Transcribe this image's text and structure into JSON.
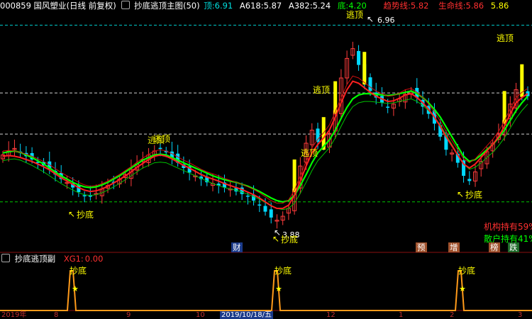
{
  "header": {
    "stock_code_name": "000859 国风塑业(日线 前复权)",
    "indicator_icon": "lock-icon",
    "indicator_name": "抄底逃顶主图(50)",
    "top_label": "顶:",
    "top_value": "6.91",
    "a618_label": "A618:",
    "a618_value": "5.87",
    "a382_label": "A382:",
    "a382_value": "5.24",
    "bottom_label": "底:",
    "bottom_value": "4.20",
    "trend_label": "趋势线:",
    "trend_value": "5.82",
    "life_label": "生命线:",
    "life_value": "5.86",
    "life_value2": "5.86",
    "colors": {
      "code": "#ffffff",
      "top": "#ffffff",
      "a": "#ffffff",
      "bottom": "#00ff00",
      "trend": "#ff3030",
      "life": "#ff3030"
    }
  },
  "annotations": {
    "escape": "逃顶",
    "escape_overlap": "逃顶",
    "bottom": "抄底",
    "price_high": "6.96",
    "price_low": "3.88",
    "arrow_high": "↖",
    "arrow_low": "↖"
  },
  "side_info": {
    "institution": "机构持有59%",
    "retail": "散户持有41%"
  },
  "badges": {
    "finance": "财",
    "forecast": "预",
    "increase": "增",
    "ranking": "榜",
    "drop": "跌"
  },
  "sub_panel": {
    "icon": "lock-icon",
    "title": "抄底逃顶副",
    "xg1_label": "XG1:",
    "xg1_value": "0.00",
    "spike_label": "抄底",
    "star_icon": "star-icon"
  },
  "date_axis": {
    "year": "2019年",
    "m8": "8",
    "m9": "9",
    "m10": "10",
    "cursor_date": "2019/10/18/五",
    "m12": "12",
    "m1": "1",
    "m2": "2",
    "m3": "3"
  },
  "chart_data": {
    "type": "candlestick",
    "title": "000859 国风塑业(日线 前复权)",
    "reference_levels": {
      "top": 6.91,
      "a618": 5.87,
      "a382": 5.24,
      "bottom": 4.2
    },
    "trend_line_last": 5.82,
    "life_line_last": 5.86,
    "annotated_prices": {
      "high": 6.96,
      "low": 3.88
    },
    "ylim": [
      3.6,
      7.1
    ],
    "close_path": [
      4.92,
      4.98,
      5.02,
      4.95,
      4.9,
      4.85,
      4.8,
      4.76,
      4.7,
      4.62,
      4.55,
      4.5,
      4.42,
      4.35,
      4.3,
      4.28,
      4.33,
      4.4,
      4.45,
      4.5,
      4.55,
      4.62,
      4.7,
      4.78,
      4.85,
      4.92,
      4.98,
      5.02,
      4.96,
      4.88,
      4.8,
      4.72,
      4.65,
      4.6,
      4.55,
      4.5,
      4.48,
      4.45,
      4.42,
      4.4,
      4.36,
      4.32,
      4.28,
      4.22,
      4.15,
      4.05,
      3.96,
      3.92,
      3.98,
      4.1,
      4.4,
      4.75,
      5.1,
      5.3,
      5.12,
      5.05,
      5.25,
      5.6,
      6.1,
      6.4,
      6.55,
      6.3,
      6.05,
      5.9,
      5.8,
      5.72,
      5.65,
      5.7,
      5.78,
      5.85,
      5.9,
      5.8,
      5.66,
      5.55,
      5.4,
      5.2,
      5.0,
      4.95,
      4.8,
      4.6,
      4.52,
      4.66,
      4.82,
      4.97,
      5.1,
      5.25,
      5.45,
      5.7,
      5.92,
      5.86,
      5.82
    ],
    "ma_green": [
      4.95,
      4.97,
      4.98,
      4.96,
      4.92,
      4.88,
      4.83,
      4.78,
      4.72,
      4.66,
      4.6,
      4.55,
      4.5,
      4.46,
      4.43,
      4.42,
      4.43,
      4.46,
      4.5,
      4.55,
      4.6,
      4.66,
      4.72,
      4.78,
      4.84,
      4.88,
      4.92,
      4.93,
      4.92,
      4.88,
      4.84,
      4.8,
      4.76,
      4.72,
      4.68,
      4.64,
      4.6,
      4.57,
      4.54,
      4.52,
      4.5,
      4.47,
      4.44,
      4.4,
      4.36,
      4.31,
      4.26,
      4.22,
      4.2,
      4.22,
      4.3,
      4.45,
      4.62,
      4.8,
      4.95,
      5.05,
      5.15,
      5.3,
      5.48,
      5.65,
      5.78,
      5.84,
      5.86,
      5.86,
      5.85,
      5.84,
      5.83,
      5.84,
      5.86,
      5.88,
      5.9,
      5.86,
      5.8,
      5.72,
      5.62,
      5.5,
      5.35,
      5.2,
      5.05,
      4.9,
      4.82,
      4.85,
      4.92,
      5.0,
      5.08,
      5.18,
      5.3,
      5.45,
      5.6,
      5.72,
      5.82
    ],
    "ma_red": [
      4.9,
      4.91,
      4.9,
      4.88,
      4.85,
      4.82,
      4.78,
      4.74,
      4.69,
      4.63,
      4.57,
      4.52,
      4.47,
      4.42,
      4.38,
      4.36,
      4.37,
      4.4,
      4.44,
      4.49,
      4.54,
      4.6,
      4.66,
      4.73,
      4.79,
      4.85,
      4.9,
      4.92,
      4.9,
      4.86,
      4.81,
      4.76,
      4.72,
      4.67,
      4.62,
      4.58,
      4.55,
      4.52,
      4.48,
      4.45,
      4.42,
      4.39,
      4.35,
      4.31,
      4.26,
      4.2,
      4.14,
      4.1,
      4.1,
      4.15,
      4.3,
      4.52,
      4.75,
      4.95,
      5.08,
      5.18,
      5.3,
      5.5,
      5.72,
      5.92,
      6.05,
      6.02,
      5.95,
      5.88,
      5.82,
      5.78,
      5.74,
      5.75,
      5.79,
      5.84,
      5.86,
      5.8,
      5.72,
      5.62,
      5.5,
      5.36,
      5.2,
      5.06,
      4.92,
      4.78,
      4.72,
      4.78,
      4.88,
      4.98,
      5.08,
      5.2,
      5.36,
      5.55,
      5.72,
      5.8,
      5.86
    ],
    "bottom_signal_positions": [
      8,
      52,
      86
    ]
  }
}
